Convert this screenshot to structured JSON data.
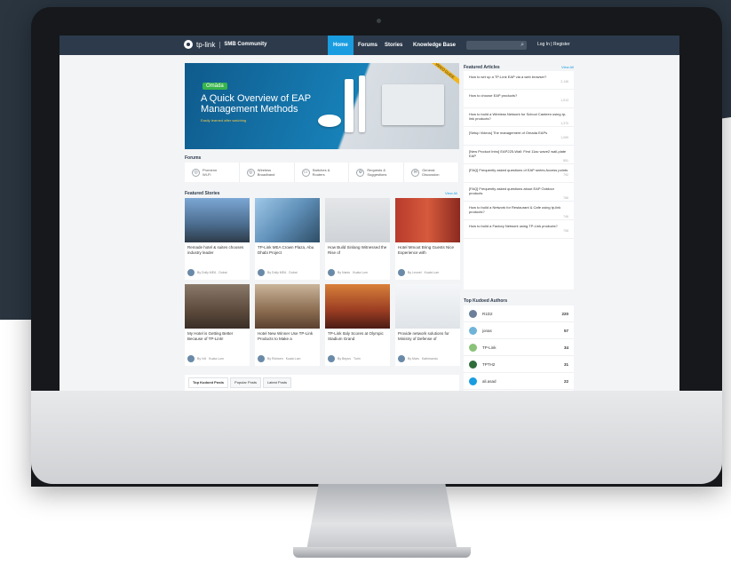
{
  "nav": {
    "brand": "tp-link",
    "community": "SMB Community",
    "items": [
      "Home",
      "Forums",
      "Stories",
      "Knowledge Base"
    ],
    "login": "Log In",
    "register": "Register"
  },
  "hero": {
    "brand": "Omāda",
    "title": "A Quick Overview of EAP Management Methods",
    "subtitle": "Easily learned after watching",
    "ribbon": "VIDEO GUIDE"
  },
  "forums": {
    "title": "Forums",
    "items": [
      {
        "label": "Promenn",
        "sub": "Wi-Fi"
      },
      {
        "label": "Wireless",
        "sub": "Broadband"
      },
      {
        "label": "Switches &",
        "sub": "Routers"
      },
      {
        "label": "Requests &",
        "sub": "Suggestions"
      },
      {
        "label": "General",
        "sub": "Discussion"
      }
    ]
  },
  "stories": {
    "title": "Featured Stories",
    "view_all": "View All",
    "cards": [
      {
        "caption": "Remade hotel & suites chooses industry leader",
        "author": "By Dolly MEA",
        "loc": "Dubai"
      },
      {
        "caption": "TP-Link MEA Crown Plaza, Abu Dhabi Project",
        "author": "By Dolly MEA",
        "loc": "Dubai"
      },
      {
        "caption": "How Build Sinlang Witnessed the Rise of",
        "author": "By Nanio",
        "loc": "Kuala Lum"
      },
      {
        "caption": "Hotel Mmoot Bring Guests Nice Experience with",
        "author": "By Leonel",
        "loc": "Kuala Lum"
      },
      {
        "caption": "My Hotel is Getting Better Because of TP-Link!",
        "author": "By Vdi",
        "loc": "Kuala Lum"
      },
      {
        "caption": "Hotel New Winner Use TP-Link Products to Make a",
        "author": "By Richsen",
        "loc": "Kuala Lum"
      },
      {
        "caption": "TP-Link Italy Scores at Olympic Stadium Grand",
        "author": "By Bepus",
        "loc": "Turin"
      },
      {
        "caption": "Provide network solutions for Ministry of Defense of",
        "author": "By Mars",
        "loc": "Kathmandu"
      }
    ]
  },
  "tabs": [
    "Top Kudoed Posts",
    "Popular Posts",
    "Latest Posts"
  ],
  "featured_articles": {
    "title": "Featured Articles",
    "view_all": "View All",
    "items": [
      {
        "title": "How to set up a TP-Link EAP via a web browser?",
        "views": "2,146"
      },
      {
        "title": "How to choose EAP products?",
        "views": "1,513"
      },
      {
        "title": "How to build a Wireless Network for School Canteen using tp-link products?",
        "views": "1,370"
      },
      {
        "title": "[Setup Videos] The management of Omada EAPs",
        "views": "1,059"
      },
      {
        "title": "[New Product Intro] EAP225-Wall: First 11ac wave2 wall-plate EAP",
        "views": "851"
      },
      {
        "title": "[FAQ] Frequently asked questions of EAP series Access points",
        "views": "792"
      },
      {
        "title": "[FAQ] Frequently asked questions about EAP Outdoor products",
        "views": "766"
      },
      {
        "title": "How to build a Network for Restaurant & Cafe using tp-link products?",
        "views": "746"
      },
      {
        "title": "How to build a Factory Network using TP-Link products?",
        "views": "708"
      }
    ]
  },
  "kudoed_authors": {
    "title": "Top Kudoed Authors",
    "items": [
      {
        "name": "R1D2",
        "score": "220"
      },
      {
        "name": "jonas",
        "score": "57"
      },
      {
        "name": "TP-Link",
        "score": "34"
      },
      {
        "name": "TPTH2",
        "score": "31"
      },
      {
        "name": "ali.asad",
        "score": "22"
      }
    ]
  }
}
